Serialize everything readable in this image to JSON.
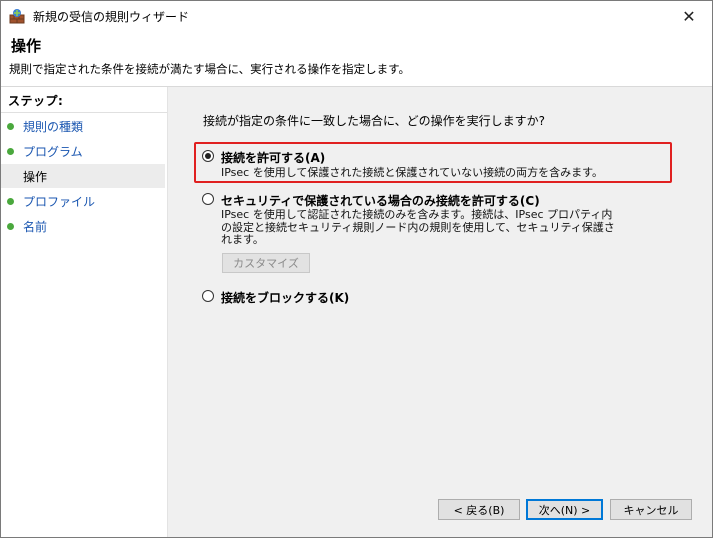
{
  "window": {
    "title": "新規の受信の規則ウィザード",
    "close_glyph": "✕"
  },
  "header": {
    "title": "操作",
    "description": "規則で指定された条件を接続が満たす場合に、実行される操作を指定します。"
  },
  "sidebar": {
    "title": "ステップ:",
    "items": [
      {
        "label": "規則の種類"
      },
      {
        "label": "プログラム"
      },
      {
        "label": "操作"
      },
      {
        "label": "プロファイル"
      },
      {
        "label": "名前"
      }
    ]
  },
  "main": {
    "question": "接続が指定の条件に一致した場合に、どの操作を実行しますか?",
    "options": [
      {
        "label": "接続を許可する(A)",
        "description": "IPsec を使用して保護された接続と保護されていない接続の両方を含みます。",
        "selected": true
      },
      {
        "label": "セキュリティで保護されている場合のみ接続を許可する(C)",
        "description_lines": [
          "IPsec を使用して認証された接続のみを含みます。接続は、IPsec プロパティ内",
          "の設定と接続セキュリティ規則ノード内の規則を使用して、セキュリティ保護さ",
          "れます。"
        ],
        "selected": false
      },
      {
        "label": "接続をブロックする(K)",
        "selected": false
      }
    ],
    "customize_label": "カスタマイズ"
  },
  "buttons": {
    "back": "< 戻る(B)",
    "next": "次へ(N) >",
    "cancel": "キャンセル"
  }
}
